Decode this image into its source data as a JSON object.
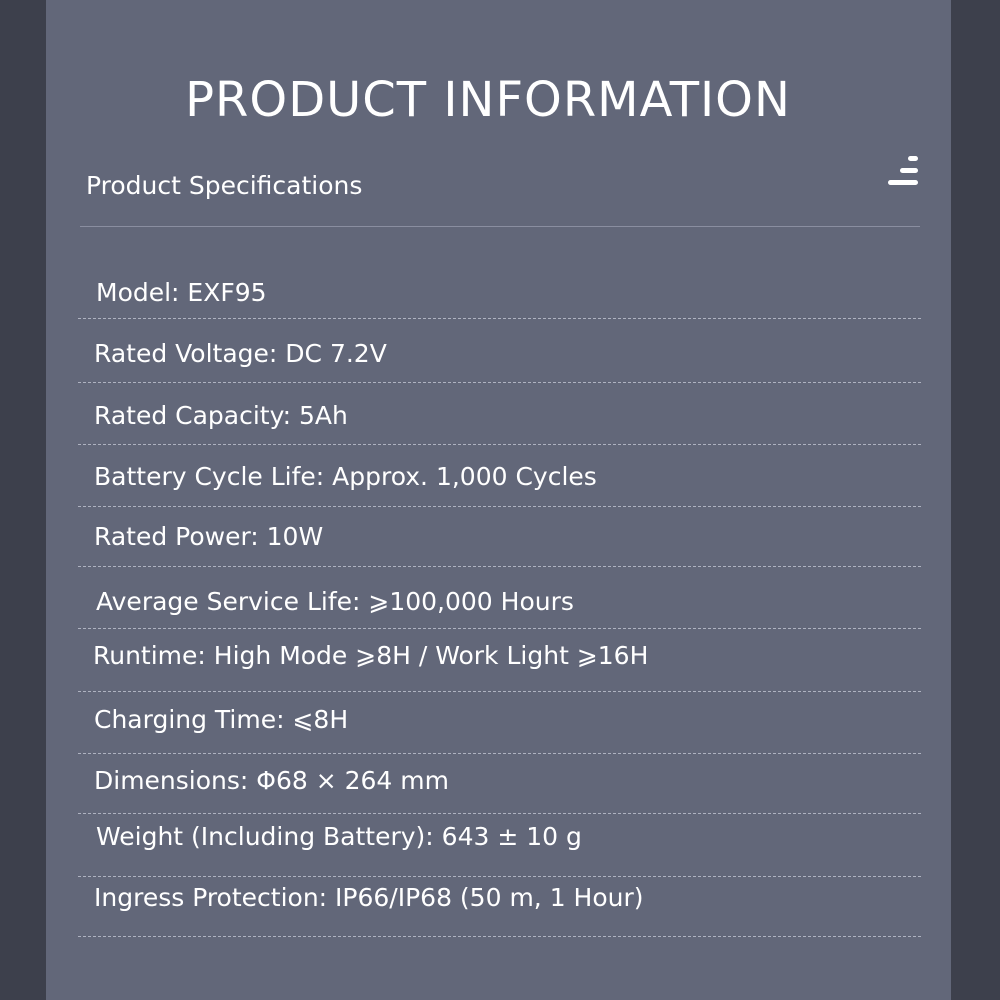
{
  "heading": "PRODUCT INFORMATION",
  "section": {
    "title": "Product Specifications",
    "icon": "menu-icon"
  },
  "specs": [
    "Model: EXF95",
    "Rated Voltage: DC 7.2V",
    "Rated Capacity: 5Ah",
    "Battery Cycle Life: Approx. 1,000 Cycles",
    "Rated Power: 10W",
    "Average Service Life: ⩾100,000 Hours",
    "Runtime: High Mode ⩾8H / Work Light ⩾16H",
    "Charging Time: ⩽8H",
    "Dimensions: Φ68 × 264 mm",
    "Weight (Including Battery): 643 ± 10 g",
    "Ingress Protection: IP66/IP68 (50 m, 1 Hour)"
  ],
  "colors": {
    "background": "#3d404c",
    "panel": "#626779",
    "text": "#ffffff"
  }
}
